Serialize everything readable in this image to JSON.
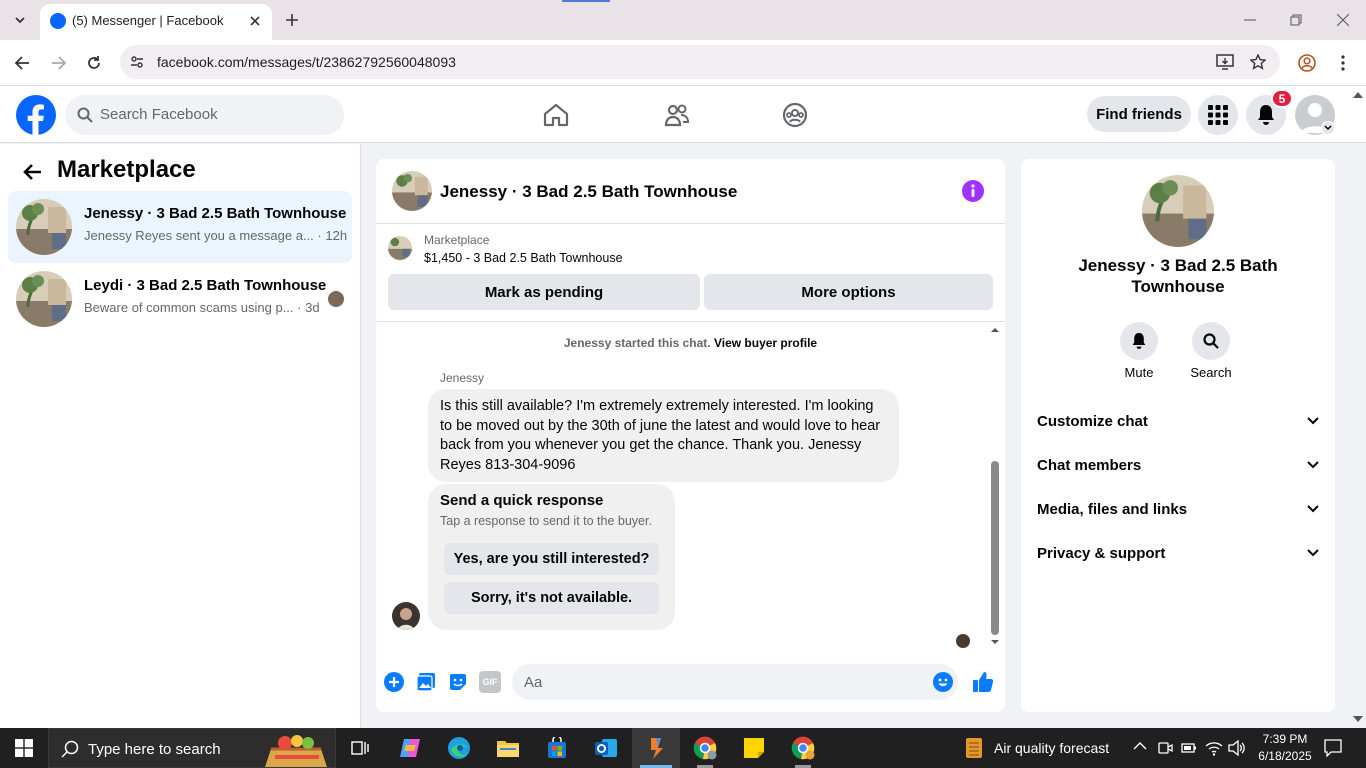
{
  "browser": {
    "tab_title": "(5) Messenger | Facebook",
    "url": "facebook.com/messages/t/23862792560048093"
  },
  "header": {
    "search_placeholder": "Search Facebook",
    "find_friends": "Find friends",
    "notification_count": "5"
  },
  "sidebar": {
    "title": "Marketplace",
    "conversations": [
      {
        "name": "Jenessy · 3 Bad 2.5 Bath Townhouse",
        "preview": "Jenessy Reyes sent you a message a...",
        "time": "· 12h"
      },
      {
        "name": "Leydi · 3 Bad 2.5 Bath Townhouse",
        "preview": "Beware of common scams using p...",
        "time": "· 3d"
      }
    ]
  },
  "chat": {
    "title": "Jenessy · 3 Bad 2.5 Bath Townhouse",
    "listing_label": "Marketplace",
    "listing_price": "$1,450 - 3 Bad 2.5 Bath Townhouse",
    "mark_pending": "Mark as pending",
    "more_options": "More options",
    "started_text": "Jenessy started this chat.",
    "view_profile": "View buyer profile",
    "sender": "Jenessy",
    "message": "Is this still available? I'm extremely extremely interested. I'm looking to be moved out by the 30th of june the latest and would love to hear back from you whenever you get the chance. Thank you. Jenessy Reyes 813-304-9096",
    "quick_title": "Send a quick response",
    "quick_sub": "Tap a response to send it to the buyer.",
    "quick_1": "Yes, are you still interested?",
    "quick_2": "Sorry, it's not available.",
    "composer_placeholder": "Aa",
    "gif": "GIF"
  },
  "details": {
    "name": "Jenessy · 3 Bad 2.5 Bath Townhouse",
    "mute": "Mute",
    "search": "Search",
    "sections": [
      "Customize chat",
      "Chat members",
      "Media, files and links",
      "Privacy & support"
    ]
  },
  "taskbar": {
    "search_placeholder": "Type here to search",
    "weather": "Air quality forecast",
    "time": "7:39 PM",
    "date": "6/18/2025"
  },
  "colors": {
    "fb_blue": "#0866ff",
    "accent_purple": "#a033ff",
    "messenger_blue": "#0a7cff"
  }
}
